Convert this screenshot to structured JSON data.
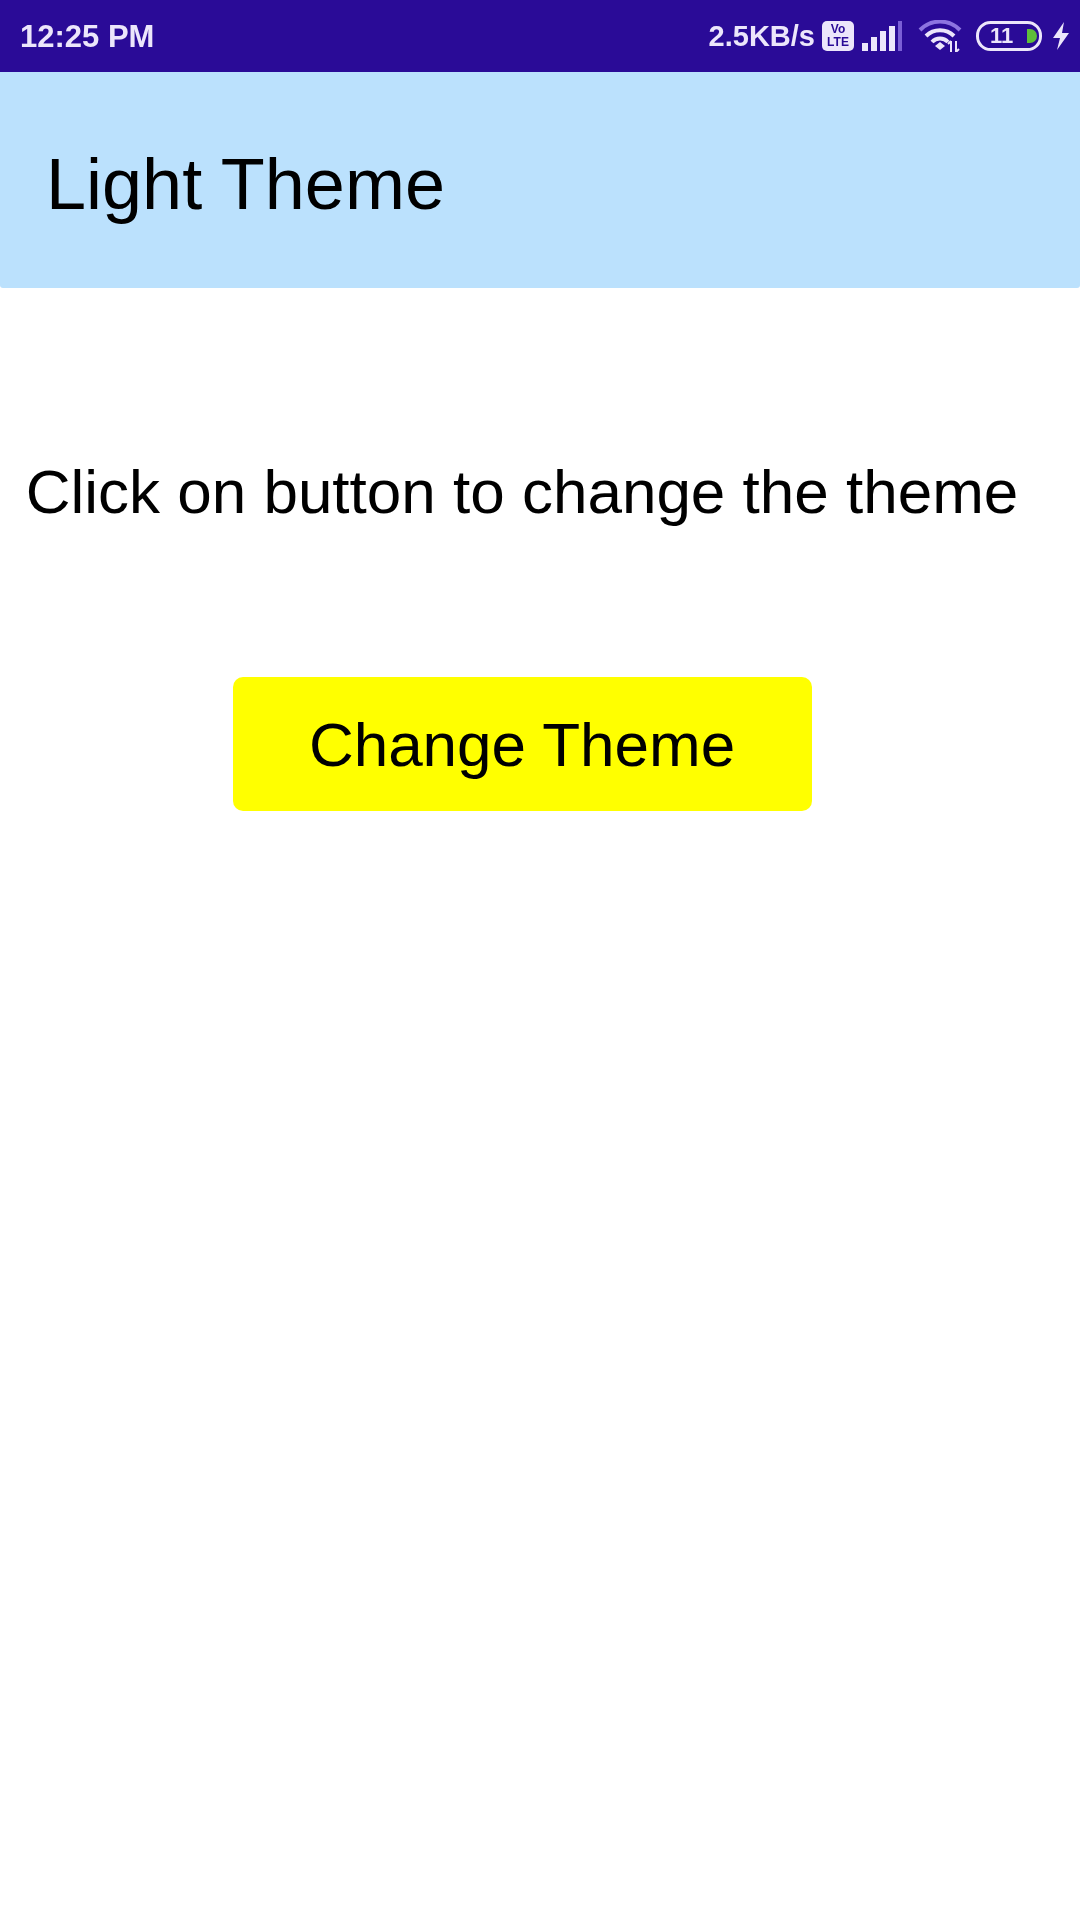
{
  "status_bar": {
    "time": "12:25 PM",
    "network_speed": "2.5KB/s",
    "network_badge": "Vo\nLTE",
    "battery_text": "11"
  },
  "app_bar": {
    "title": "Light Theme"
  },
  "content": {
    "message": "Click on button to change the theme",
    "button": {
      "label": "Change Theme"
    }
  }
}
